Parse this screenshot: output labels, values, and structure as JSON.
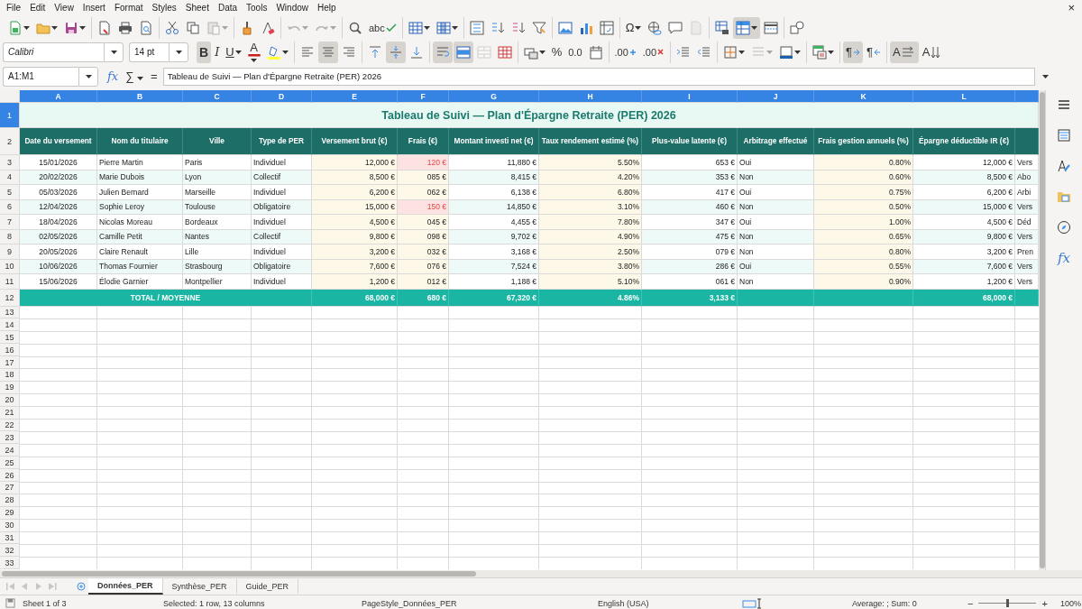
{
  "window": {
    "close": "×"
  },
  "menu": [
    "File",
    "Edit",
    "View",
    "Insert",
    "Format",
    "Styles",
    "Sheet",
    "Data",
    "Tools",
    "Window",
    "Help"
  ],
  "toolbar_standard": [
    [
      {
        "kind": "new",
        "dropdown": true,
        "pressed": false,
        "disabled": false
      },
      {
        "kind": "open",
        "dropdown": true,
        "pressed": false,
        "disabled": false
      },
      {
        "kind": "save",
        "dropdown": true,
        "pressed": false,
        "disabled": false
      }
    ],
    [
      {
        "kind": "pdf",
        "dropdown": false,
        "pressed": false,
        "disabled": false
      },
      {
        "kind": "print",
        "dropdown": false,
        "pressed": false,
        "disabled": false
      },
      {
        "kind": "preview",
        "dropdown": false,
        "pressed": false,
        "disabled": false
      }
    ],
    [
      {
        "kind": "cut",
        "dropdown": false,
        "pressed": false,
        "disabled": false
      },
      {
        "kind": "copy",
        "dropdown": false,
        "pressed": false,
        "disabled": false
      },
      {
        "kind": "paste",
        "dropdown": true,
        "pressed": false,
        "disabled": true
      }
    ],
    [
      {
        "kind": "brush",
        "dropdown": false,
        "pressed": false,
        "disabled": false
      },
      {
        "kind": "clearfmt",
        "dropdown": false,
        "pressed": false,
        "disabled": false
      }
    ],
    [
      {
        "kind": "undo",
        "dropdown": true,
        "pressed": false,
        "disabled": true
      },
      {
        "kind": "redo",
        "dropdown": true,
        "pressed": false,
        "disabled": true
      }
    ],
    [
      {
        "kind": "find",
        "dropdown": false,
        "pressed": false,
        "disabled": false
      },
      {
        "kind": "spell",
        "glyph": "abc",
        "dropdown": false,
        "pressed": false,
        "disabled": false
      }
    ],
    [
      {
        "kind": "rows",
        "dropdown": true,
        "pressed": false,
        "disabled": false
      },
      {
        "kind": "cols",
        "dropdown": true,
        "pressed": false,
        "disabled": false
      }
    ],
    [
      {
        "kind": "sort",
        "dropdown": false,
        "pressed": false,
        "disabled": false
      },
      {
        "kind": "sortasc",
        "dropdown": false,
        "pressed": false,
        "disabled": false
      },
      {
        "kind": "sortdesc",
        "dropdown": false,
        "pressed": false,
        "disabled": false
      },
      {
        "kind": "filter",
        "dropdown": false,
        "pressed": false,
        "disabled": false
      }
    ],
    [
      {
        "kind": "image",
        "dropdown": false,
        "pressed": false,
        "disabled": false
      },
      {
        "kind": "chart",
        "dropdown": false,
        "pressed": false,
        "disabled": false
      },
      {
        "kind": "pivot",
        "dropdown": false,
        "pressed": false,
        "disabled": false
      }
    ],
    [
      {
        "kind": "special",
        "glyph": "Ω",
        "dropdown": true,
        "pressed": false,
        "disabled": false
      },
      {
        "kind": "link",
        "dropdown": false,
        "pressed": false,
        "disabled": false
      },
      {
        "kind": "comment",
        "dropdown": false,
        "pressed": false,
        "disabled": false
      },
      {
        "kind": "headerfooter",
        "dropdown": false,
        "pressed": false,
        "disabled": true
      }
    ],
    [
      {
        "kind": "printarea",
        "dropdown": false,
        "pressed": false,
        "disabled": false
      },
      {
        "kind": "freeze",
        "dropdown": true,
        "pressed": true,
        "disabled": false
      },
      {
        "kind": "split",
        "dropdown": false,
        "pressed": false,
        "disabled": false
      }
    ],
    [
      {
        "kind": "shapes",
        "dropdown": false,
        "pressed": false,
        "disabled": false
      }
    ]
  ],
  "font_name": {
    "value": "Calibri"
  },
  "font_size": {
    "value": "14 pt"
  },
  "toolbar_formatting": [
    [
      {
        "kind": "bold",
        "glyph": "B",
        "dropdown": false,
        "pressed": true,
        "disabled": false
      },
      {
        "kind": "italic",
        "glyph": "I",
        "dropdown": false,
        "pressed": false,
        "disabled": false
      },
      {
        "kind": "underline",
        "glyph": "U",
        "dropdown": true,
        "pressed": false,
        "disabled": false
      },
      {
        "kind": "fontcolor",
        "glyph": "A",
        "dropdown": true,
        "pressed": false,
        "disabled": false
      },
      {
        "kind": "highlight",
        "dropdown": true,
        "pressed": false,
        "disabled": false
      }
    ],
    [
      {
        "kind": "alignleft",
        "dropdown": false,
        "pressed": false,
        "disabled": false
      },
      {
        "kind": "aligncenter",
        "dropdown": false,
        "pressed": true,
        "disabled": false
      },
      {
        "kind": "alignright",
        "dropdown": false,
        "pressed": false,
        "disabled": false
      }
    ],
    [
      {
        "kind": "aligntop",
        "dropdown": false,
        "pressed": false,
        "disabled": false
      },
      {
        "kind": "alignmiddle",
        "dropdown": false,
        "pressed": true,
        "disabled": false
      },
      {
        "kind": "alignbottom",
        "dropdown": false,
        "pressed": false,
        "disabled": false
      }
    ],
    [
      {
        "kind": "wrap",
        "dropdown": false,
        "pressed": true,
        "disabled": false
      },
      {
        "kind": "mergecenter",
        "dropdown": false,
        "pressed": true,
        "disabled": false
      },
      {
        "kind": "merge",
        "dropdown": false,
        "pressed": false,
        "disabled": true
      },
      {
        "kind": "unmerge",
        "dropdown": false,
        "pressed": false,
        "disabled": false
      }
    ],
    [
      {
        "kind": "currency",
        "dropdown": true,
        "pressed": false,
        "disabled": false
      },
      {
        "kind": "percent",
        "glyph": "%",
        "dropdown": false,
        "pressed": false,
        "disabled": false
      },
      {
        "kind": "number",
        "glyph": "0.0",
        "dropdown": false,
        "pressed": false,
        "disabled": false
      },
      {
        "kind": "date",
        "dropdown": false,
        "pressed": false,
        "disabled": false
      }
    ],
    [
      {
        "kind": "adddecimal",
        "glyph": ".00",
        "dropdown": false,
        "pressed": false,
        "disabled": false
      },
      {
        "kind": "deldecimal",
        "glyph": ".00",
        "dropdown": false,
        "pressed": false,
        "disabled": false
      }
    ],
    [
      {
        "kind": "indentinc",
        "dropdown": false,
        "pressed": false,
        "disabled": false
      },
      {
        "kind": "indentdec",
        "dropdown": false,
        "pressed": false,
        "disabled": false
      }
    ],
    [
      {
        "kind": "borders",
        "dropdown": true,
        "pressed": false,
        "disabled": false
      },
      {
        "kind": "borderstyle",
        "dropdown": true,
        "pressed": false,
        "disabled": true
      },
      {
        "kind": "bordercolor",
        "dropdown": true,
        "pressed": false,
        "disabled": false
      }
    ],
    [
      {
        "kind": "conditional",
        "dropdown": true,
        "pressed": false,
        "disabled": false
      }
    ],
    [
      {
        "kind": "ltr",
        "glyph": "¶",
        "dropdown": false,
        "pressed": true,
        "disabled": false
      },
      {
        "kind": "rtl",
        "glyph": "¶",
        "dropdown": false,
        "pressed": false,
        "disabled": false
      }
    ],
    [
      {
        "kind": "stacked",
        "glyph": "A",
        "dropdown": false,
        "pressed": true,
        "disabled": false
      },
      {
        "kind": "vertical",
        "glyph": "A",
        "dropdown": false,
        "pressed": false,
        "disabled": false
      }
    ]
  ],
  "name_box": {
    "value": "A1:M1"
  },
  "formula_bar": {
    "fx": "fx",
    "sigma": "∑",
    "equals": "=",
    "value": "Tableau de Suivi — Plan d'Épargne Retraite (PER) 2026"
  },
  "sidebar": [
    {
      "kind": "menu"
    },
    {
      "kind": "properties"
    },
    {
      "kind": "styles"
    },
    {
      "kind": "gallery"
    },
    {
      "kind": "navigator"
    },
    {
      "kind": "functions",
      "glyph": "fx"
    }
  ],
  "sheet": {
    "column_headers": [
      {
        "label": "A",
        "selected": true
      },
      {
        "label": "B",
        "selected": true
      },
      {
        "label": "C",
        "selected": true
      },
      {
        "label": "D",
        "selected": true
      },
      {
        "label": "E",
        "selected": true
      },
      {
        "label": "F",
        "selected": true
      },
      {
        "label": "G",
        "selected": true
      },
      {
        "label": "H",
        "selected": true
      },
      {
        "label": "I",
        "selected": true
      },
      {
        "label": "J",
        "selected": true
      },
      {
        "label": "K",
        "selected": true
      },
      {
        "label": "L",
        "selected": true
      },
      {
        "selected": true
      }
    ],
    "title_row": {
      "label": "1",
      "selected": true,
      "title": "Tableau de Suivi — Plan d'Épargne Retraite (PER) 2026"
    },
    "header_row": {
      "label": "2",
      "selected": false,
      "headers": [
        "Date du versement",
        "Nom du titulaire",
        "Ville",
        "Type de PER",
        "Versement brut (€)",
        "Frais (€)",
        "Montant investi net (€)",
        "Taux rendement estimé (%)",
        "Plus-value latente (€)",
        "Arbitrage effectué",
        "Frais gestion annuels (%)",
        "Épargne déductible IR (€)"
      ]
    },
    "rows": [
      {
        "label": "3",
        "selected": false,
        "fee_alert": true,
        "cells": [
          "15/01/2026",
          "Pierre Martin",
          "Paris",
          "Individuel",
          "12,000 €",
          "120 €",
          "11,880 €",
          "5.50%",
          "653 €",
          "Oui",
          "0.80%",
          "12,000 €",
          "Vers"
        ]
      },
      {
        "label": "4",
        "selected": false,
        "fee_alert": false,
        "cells": [
          "20/02/2026",
          "Marie Dubois",
          "Lyon",
          "Collectif",
          "8,500 €",
          "085 €",
          "8,415 €",
          "4.20%",
          "353 €",
          "Non",
          "0.60%",
          "8,500 €",
          "Abo"
        ]
      },
      {
        "label": "5",
        "selected": false,
        "fee_alert": false,
        "cells": [
          "05/03/2026",
          "Julien Bernard",
          "Marseille",
          "Individuel",
          "6,200 €",
          "062 €",
          "6,138 €",
          "6.80%",
          "417 €",
          "Oui",
          "0.75%",
          "6,200 €",
          "Arbi"
        ]
      },
      {
        "label": "6",
        "selected": false,
        "fee_alert": true,
        "cells": [
          "12/04/2026",
          "Sophie Leroy",
          "Toulouse",
          "Obligatoire",
          "15,000 €",
          "150 €",
          "14,850 €",
          "3.10%",
          "460 €",
          "Non",
          "0.50%",
          "15,000 €",
          "Vers"
        ]
      },
      {
        "label": "7",
        "selected": false,
        "fee_alert": false,
        "cells": [
          "18/04/2026",
          "Nicolas Moreau",
          "Bordeaux",
          "Individuel",
          "4,500 €",
          "045 €",
          "4,455 €",
          "7.80%",
          "347 €",
          "Oui",
          "1.00%",
          "4,500 €",
          "Déd"
        ]
      },
      {
        "label": "8",
        "selected": false,
        "fee_alert": false,
        "cells": [
          "02/05/2026",
          "Camille Petit",
          "Nantes",
          "Collectif",
          "9,800 €",
          "098 €",
          "9,702 €",
          "4.90%",
          "475 €",
          "Non",
          "0.65%",
          "9,800 €",
          "Vers"
        ]
      },
      {
        "label": "9",
        "selected": false,
        "fee_alert": false,
        "cells": [
          "20/05/2026",
          "Claire Renault",
          "Lille",
          "Individuel",
          "3,200 €",
          "032 €",
          "3,168 €",
          "2.50%",
          "079 €",
          "Non",
          "0.80%",
          "3,200 €",
          "Pren"
        ]
      },
      {
        "label": "10",
        "selected": false,
        "fee_alert": false,
        "cells": [
          "10/06/2026",
          "Thomas Fournier",
          "Strasbourg",
          "Obligatoire",
          "7,600 €",
          "076 €",
          "7,524 €",
          "3.80%",
          "286 €",
          "Oui",
          "0.55%",
          "7,600 €",
          "Vers"
        ]
      },
      {
        "label": "11",
        "selected": false,
        "fee_alert": false,
        "cells": [
          "15/06/2026",
          "Élodie Garnier",
          "Montpellier",
          "Individuel",
          "1,200 €",
          "012 €",
          "1,188 €",
          "5.10%",
          "061 €",
          "Non",
          "0.90%",
          "1,200 €",
          "Vers"
        ]
      }
    ],
    "total_row": {
      "label": "12",
      "selected": false,
      "title": "TOTAL / MOYENNE",
      "cells": [
        "68,000 €",
        "680 €",
        "67,320 €",
        "4.86%",
        "3,133 €",
        null,
        null,
        "68,000 €"
      ]
    },
    "empty_rows": [
      {
        "label": "13",
        "selected": false
      },
      {
        "label": "14",
        "selected": false
      },
      {
        "label": "15",
        "selected": false
      },
      {
        "label": "16",
        "selected": false
      },
      {
        "label": "17",
        "selected": false
      },
      {
        "label": "18",
        "selected": false
      },
      {
        "label": "19",
        "selected": false
      },
      {
        "label": "20",
        "selected": false
      },
      {
        "label": "21",
        "selected": false
      },
      {
        "label": "22",
        "selected": false
      },
      {
        "label": "23",
        "selected": false
      },
      {
        "label": "24",
        "selected": false
      },
      {
        "label": "25",
        "selected": false
      },
      {
        "label": "26",
        "selected": false
      },
      {
        "label": "27",
        "selected": false
      },
      {
        "label": "28",
        "selected": false
      },
      {
        "label": "29",
        "selected": false
      },
      {
        "label": "30",
        "selected": false
      },
      {
        "label": "31",
        "selected": false
      },
      {
        "label": "32",
        "selected": false
      },
      {
        "label": "33",
        "selected": false
      }
    ]
  },
  "sheet_tabs": [
    {
      "label": "Données_PER",
      "selected": true
    },
    {
      "label": "Synthèse_PER",
      "selected": false
    },
    {
      "label": "Guide_PER",
      "selected": false
    }
  ],
  "status_bar": {
    "sheet": "Sheet 1 of 3",
    "selection": "Selected: 1 row, 13 columns",
    "page_style": "PageStyle_Données_PER",
    "language": "English (USA)",
    "summary": "Average: ; Sum: 0",
    "zoom": {
      "minus": "−",
      "plus": "+",
      "level": 0.5,
      "reading": "100%"
    }
  }
}
